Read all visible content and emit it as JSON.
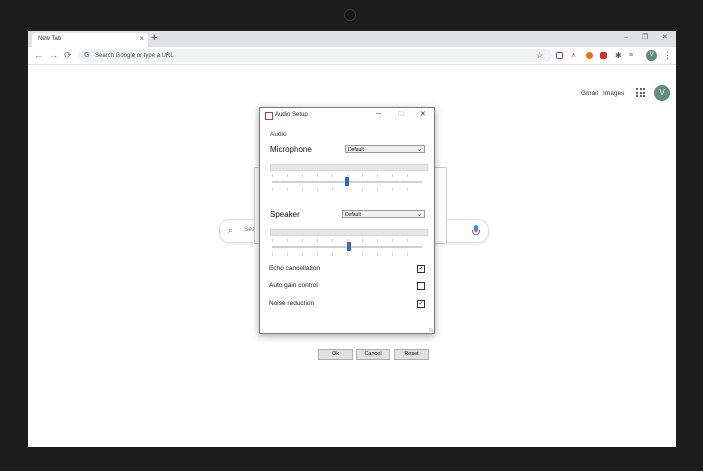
{
  "browser": {
    "tab_title": "New Tab",
    "tab_close": "×",
    "new_tab": "+",
    "window_controls": {
      "minimize": "–",
      "restore": "❐",
      "close": "✕"
    },
    "omnibox_placeholder": "Search Google or type a URL",
    "profile_initial": "V",
    "menu": "⋮"
  },
  "google": {
    "gmail": "Gmail",
    "images": "Images",
    "avatar_initial": "V",
    "search_placeholder": "Sea"
  },
  "dialog": {
    "title": "Audio Setup",
    "controls": {
      "minimize": "─",
      "maximize": "☐",
      "close": "✕"
    },
    "section": "Audio",
    "microphone": {
      "label": "Microphone",
      "device": "Default",
      "level": 0.5
    },
    "speaker": {
      "label": "Speaker",
      "device": "Default",
      "level": 0.51
    },
    "options": [
      {
        "label": "Echo cancellation",
        "checked": true
      },
      {
        "label": "Auto gain control",
        "checked": false
      },
      {
        "label": "Noise reduction",
        "checked": true
      }
    ],
    "buttons": {
      "ok": "Ok",
      "cancel": "Cancel",
      "reset": "Reset"
    }
  },
  "colors": {
    "accent": "#2f6bbf",
    "avatar": "#5f8b80"
  }
}
